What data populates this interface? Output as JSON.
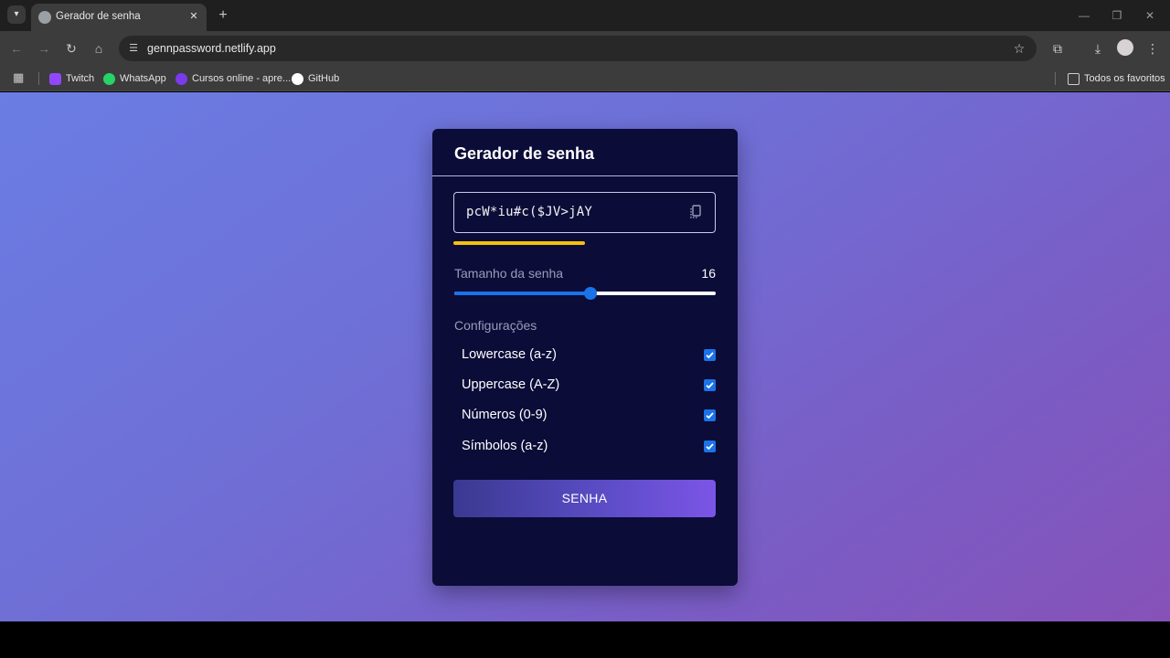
{
  "browser": {
    "tab_title": "Gerador de senha",
    "url": "gennpassword.netlify.app",
    "bookmarks": [
      {
        "label": "Twitch",
        "color": "#9146ff"
      },
      {
        "label": "WhatsApp",
        "color": "#25d366"
      },
      {
        "label": "Cursos online - apre...",
        "color": "#7c3aed"
      },
      {
        "label": "GitHub",
        "color": "#ffffff"
      }
    ],
    "bookmarks_folder": "Todos os favoritos"
  },
  "app": {
    "title": "Gerador de senha",
    "password": "pcW*iu#c($JV>jAY",
    "strength_fraction": 0.5,
    "strength_color": "#f4c20d",
    "length_label": "Tamanho da senha",
    "length_value": "16",
    "slider_fraction": 0.52,
    "config_label": "Configurações",
    "options": [
      {
        "label": "Lowercase (a-z)",
        "checked": true
      },
      {
        "label": "Uppercase (A-Z)",
        "checked": true
      },
      {
        "label": "Números (0-9)",
        "checked": true
      },
      {
        "label": "Símbolos (a-z)",
        "checked": true
      }
    ],
    "button_label": "SENHA"
  }
}
